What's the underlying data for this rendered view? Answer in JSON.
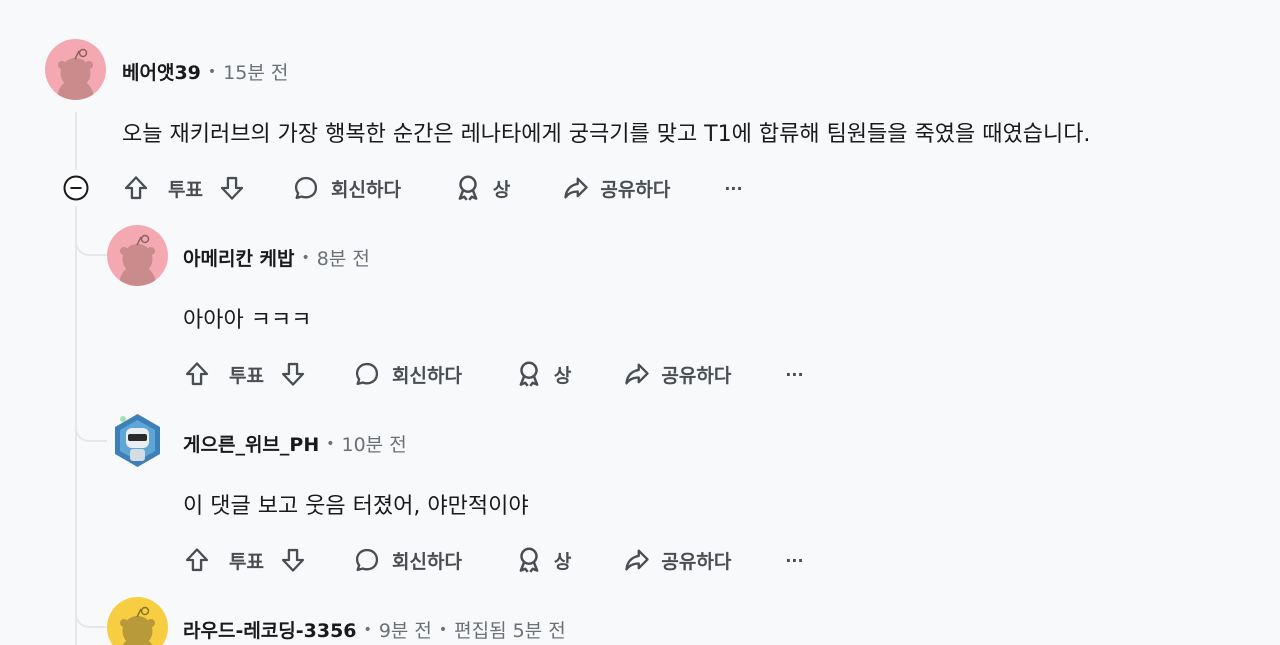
{
  "comments": [
    {
      "author": "베어앳39",
      "time": "15분 전",
      "body": "오늘 재키러브의 가장 행복한 순간은 레나타에게 궁극기를 맞고 T1에 합류해 팀원들을 죽였을 때였습니다.",
      "avatar": "snoo-avatar-pink"
    },
    {
      "author": "아메리칸 케밥",
      "time": "8분 전",
      "body": "아아아 ㅋㅋㅋ",
      "avatar": "snoo-avatar-pink"
    },
    {
      "author": "게으른_위브_PH",
      "time": "10분 전",
      "body": "이 댓글 보고 웃음 터졌어, 야만적이야",
      "avatar": "robot-avatar-blue"
    },
    {
      "author": "라우드-레코딩-3356",
      "time": "9분 전",
      "edited": "편집됨 5분 전",
      "avatar": "snoo-avatar-yellow"
    }
  ],
  "actions": {
    "vote": "투표",
    "reply": "회신하다",
    "award": "상",
    "share": "공유하다",
    "more": "···"
  },
  "colors": {
    "text": "#1a1a1b",
    "muted": "#6b7075",
    "action": "#4a4e52",
    "thread": "#e5e7ea",
    "avatar_pink": "#f3a8b2",
    "avatar_yellow": "#f7cd41"
  }
}
